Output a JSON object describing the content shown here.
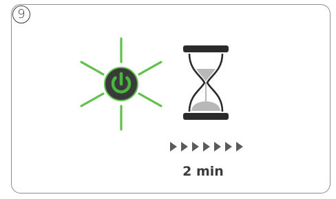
{
  "step": {
    "number": "9"
  },
  "duration": {
    "label": "2 min"
  },
  "icons": {
    "power": "power-button-icon",
    "hourglass": "hourglass-icon",
    "arrows": "progress-arrows-icon"
  },
  "progress": {
    "arrow_count": 7
  },
  "colors": {
    "glow": "#5fc14a",
    "power_symbol": "#47b83c",
    "button_body": "#3a3a3a",
    "hourglass_frame": "#2b2b2b",
    "sand": "#b8b8b8",
    "arrows": "#5a5a5a",
    "text": "#3a3a3a",
    "card_border": "#8c8c8c"
  }
}
